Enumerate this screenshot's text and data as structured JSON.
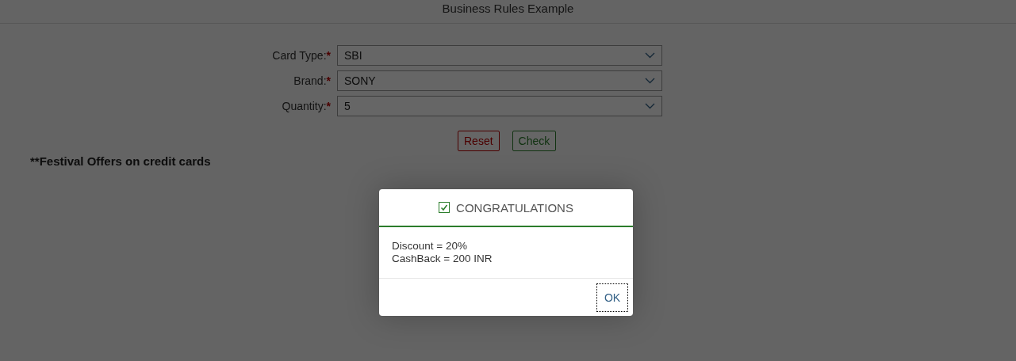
{
  "header": {
    "title": "Business Rules Example"
  },
  "form": {
    "fields": [
      {
        "label": "Card Type:",
        "required_mark": "*",
        "value": "SBI"
      },
      {
        "label": "Brand:",
        "required_mark": "*",
        "value": "SONY"
      },
      {
        "label": "Quantity:",
        "required_mark": "*",
        "value": "5"
      }
    ]
  },
  "buttons": [
    {
      "label": "Reset",
      "kind": "reset"
    },
    {
      "label": "Check",
      "kind": "check"
    }
  ],
  "offers_heading": "**Festival Offers on credit cards",
  "dialog": {
    "title": "CONGRATULATIONS",
    "lines": [
      "Discount = 20%",
      "CashBack = 200 INR"
    ],
    "button": "OK"
  }
}
